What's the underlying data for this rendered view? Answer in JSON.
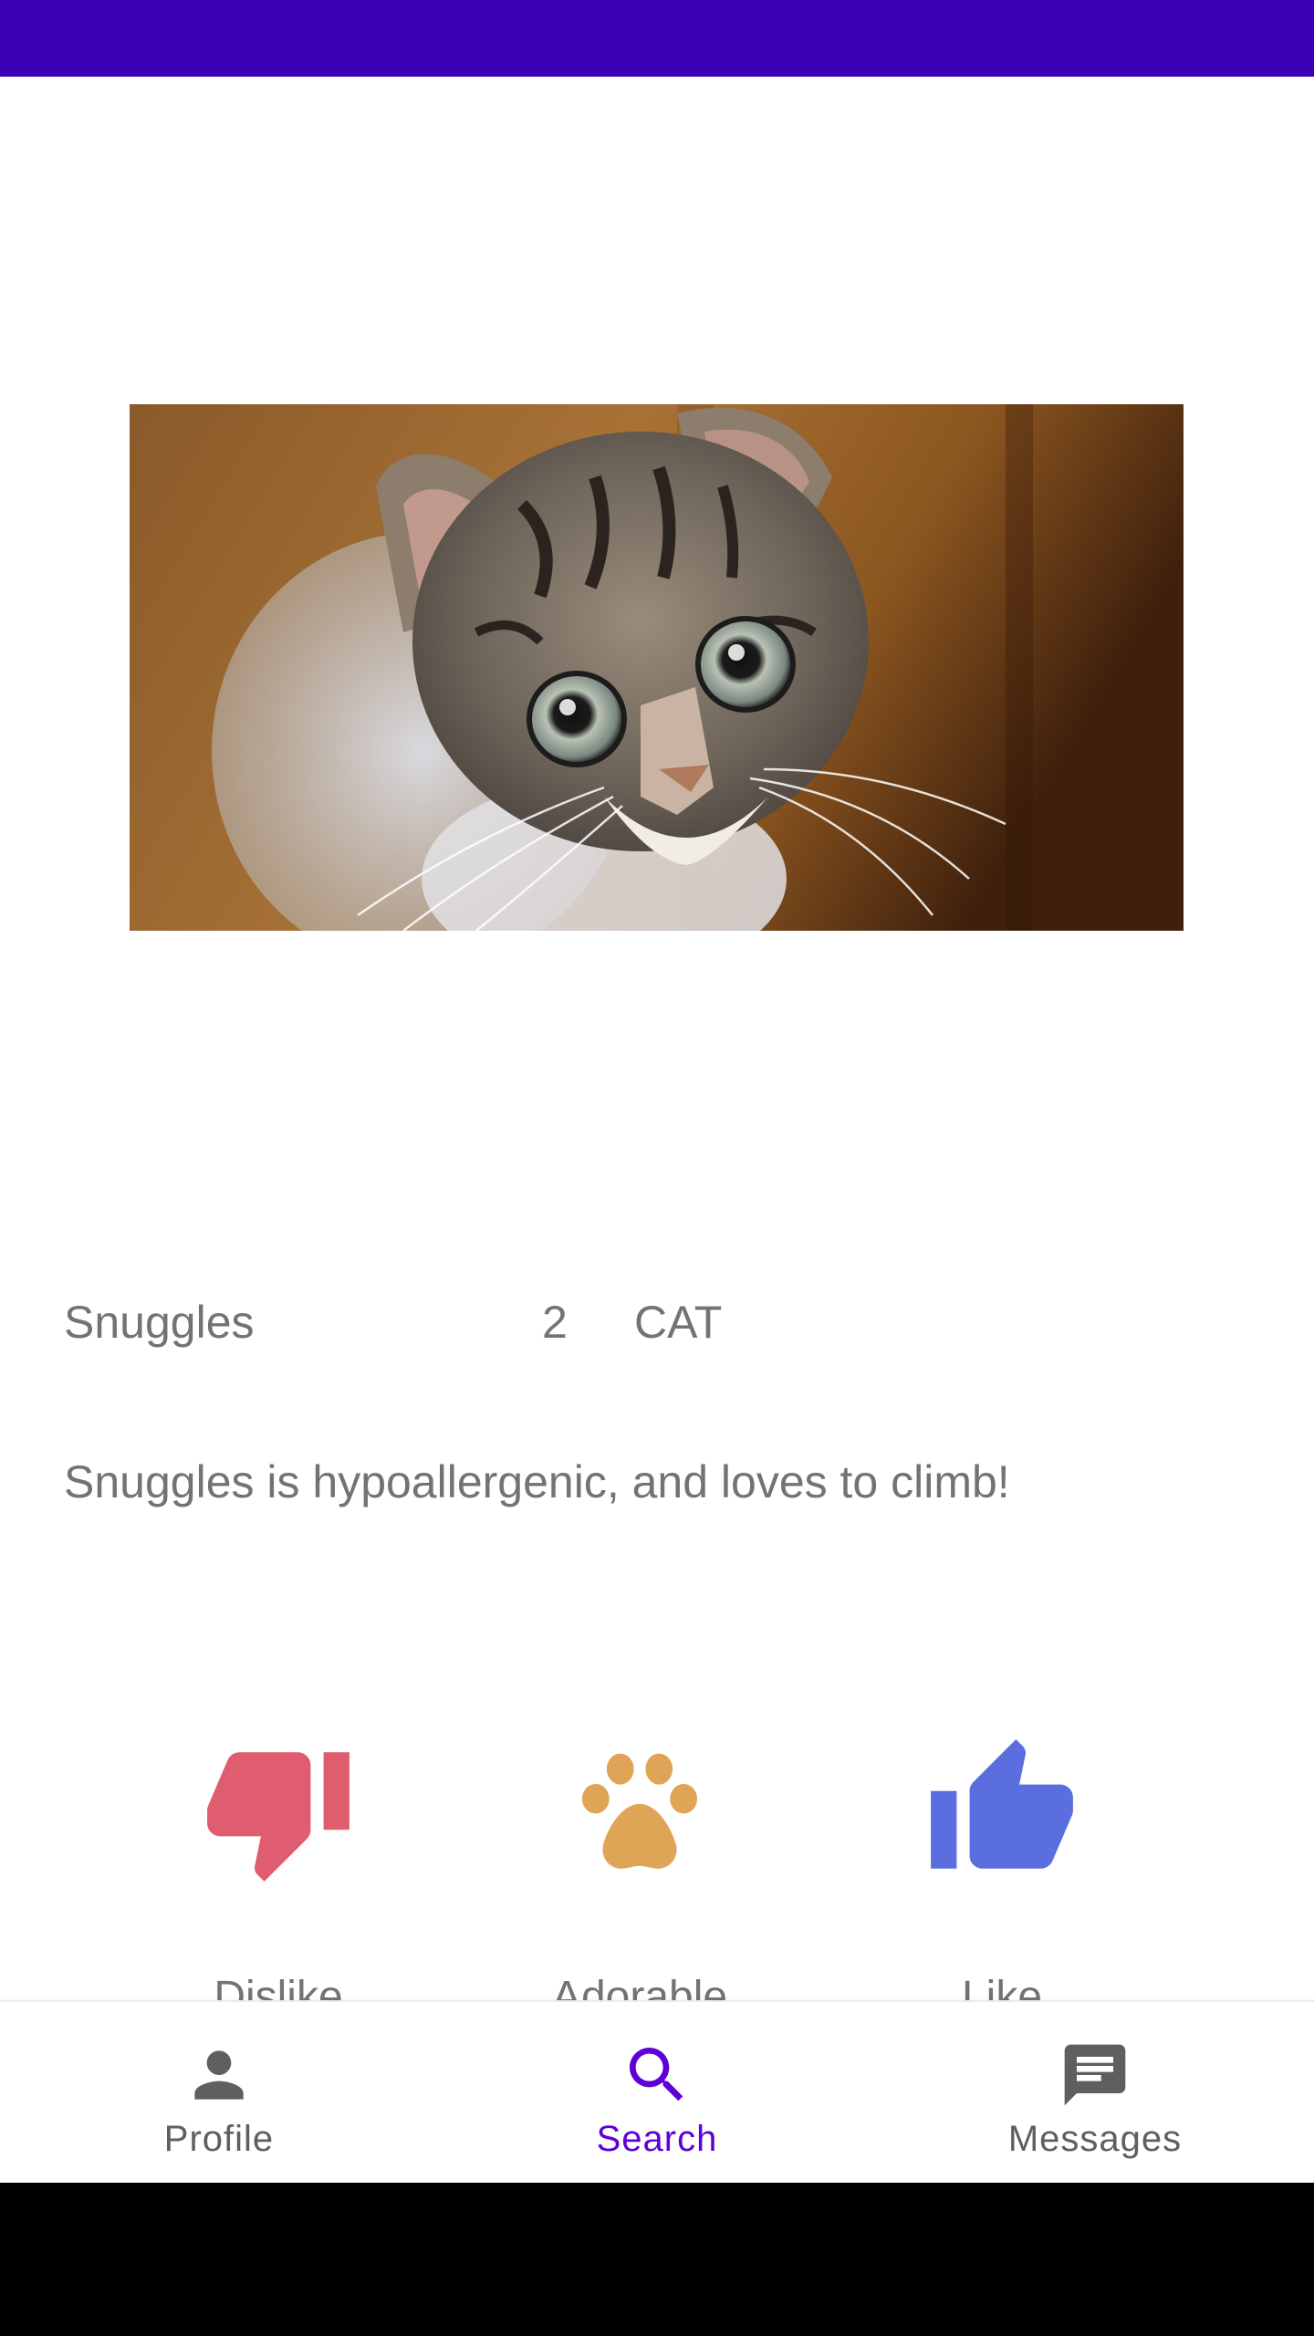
{
  "colors": {
    "status_bar": "#3d00b5",
    "system_nav": "#000000",
    "text_secondary": "#737373",
    "dislike": "#e05d6f",
    "adorable": "#e0a456",
    "like": "#5b6ee0",
    "nav_active": "#5e00d6",
    "nav_inactive": "#5f5f5f"
  },
  "pet": {
    "photo_icon": "kitten-photo",
    "name": "Snuggles",
    "age": "2",
    "type": "CAT",
    "description": "Snuggles is hypoallergenic, and loves to climb!"
  },
  "actions": [
    {
      "icon": "thumbs-down-icon",
      "label": "Dislike"
    },
    {
      "icon": "paw-icon",
      "label": "Adorable"
    },
    {
      "icon": "thumbs-up-icon",
      "label": "Like"
    }
  ],
  "bottom_nav": {
    "items": [
      {
        "icon": "person-icon",
        "label": "Profile",
        "active": false
      },
      {
        "icon": "search-icon",
        "label": "Search",
        "active": true
      },
      {
        "icon": "message-icon",
        "label": "Messages",
        "active": false
      }
    ]
  }
}
